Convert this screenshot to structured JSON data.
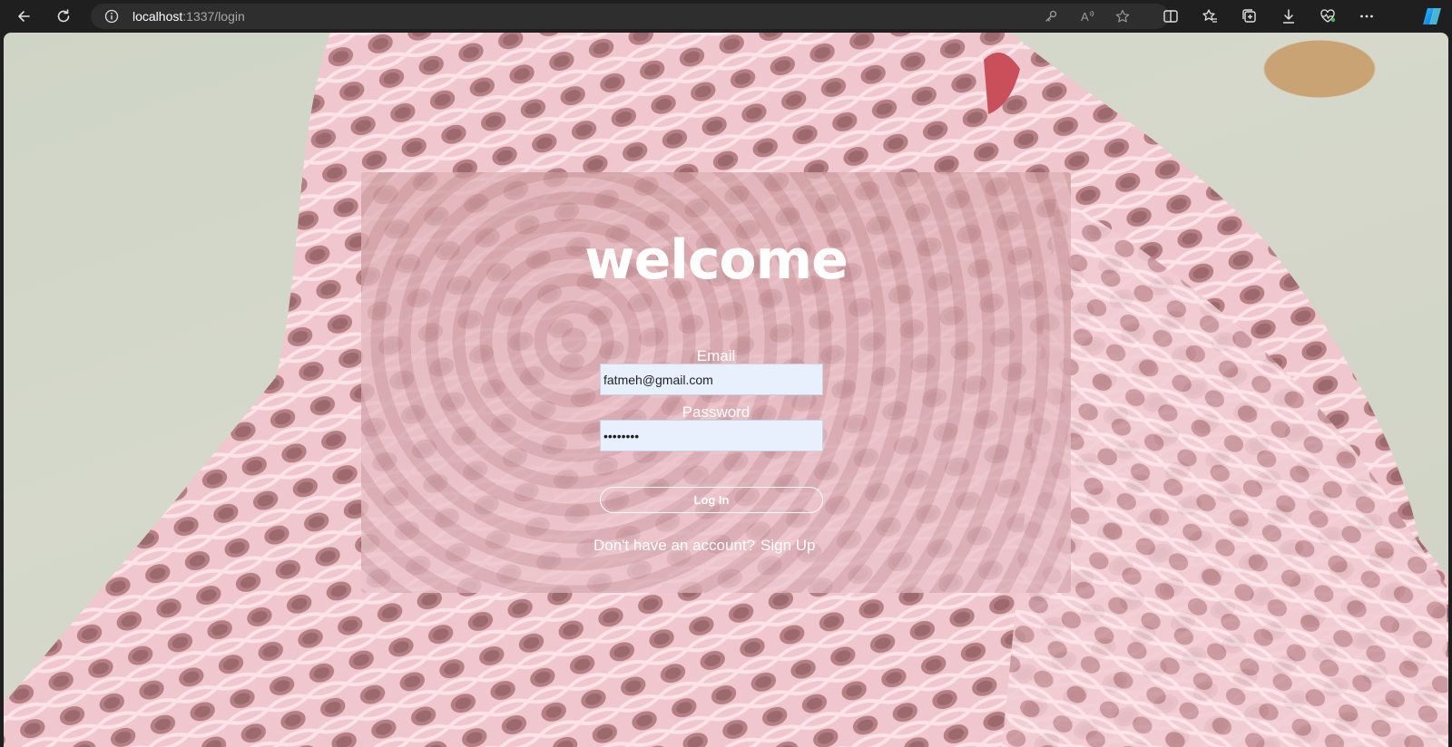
{
  "browser": {
    "url_host": "localhost",
    "url_path": ":1337/login",
    "icons": [
      "back-icon",
      "refresh-icon",
      "info-icon",
      "key-icon",
      "read-aloud-icon",
      "favorite-star-icon",
      "split-screen-icon",
      "favorites-icon",
      "collections-icon",
      "download-icon",
      "health-icon",
      "more-icon",
      "copilot-icon"
    ]
  },
  "login": {
    "title": "welcome",
    "email_label": "Email",
    "email_value": "fatmeh@gmail.com",
    "password_label": "Password",
    "password_value": "••••••••",
    "login_button": "Log In",
    "no_account_text": "Don't have an account?",
    "signup_link": "Sign Up"
  },
  "colors": {
    "card_tint": "#e6b8c0",
    "input_bg": "#e8f0fe",
    "text": "#ffffff"
  }
}
